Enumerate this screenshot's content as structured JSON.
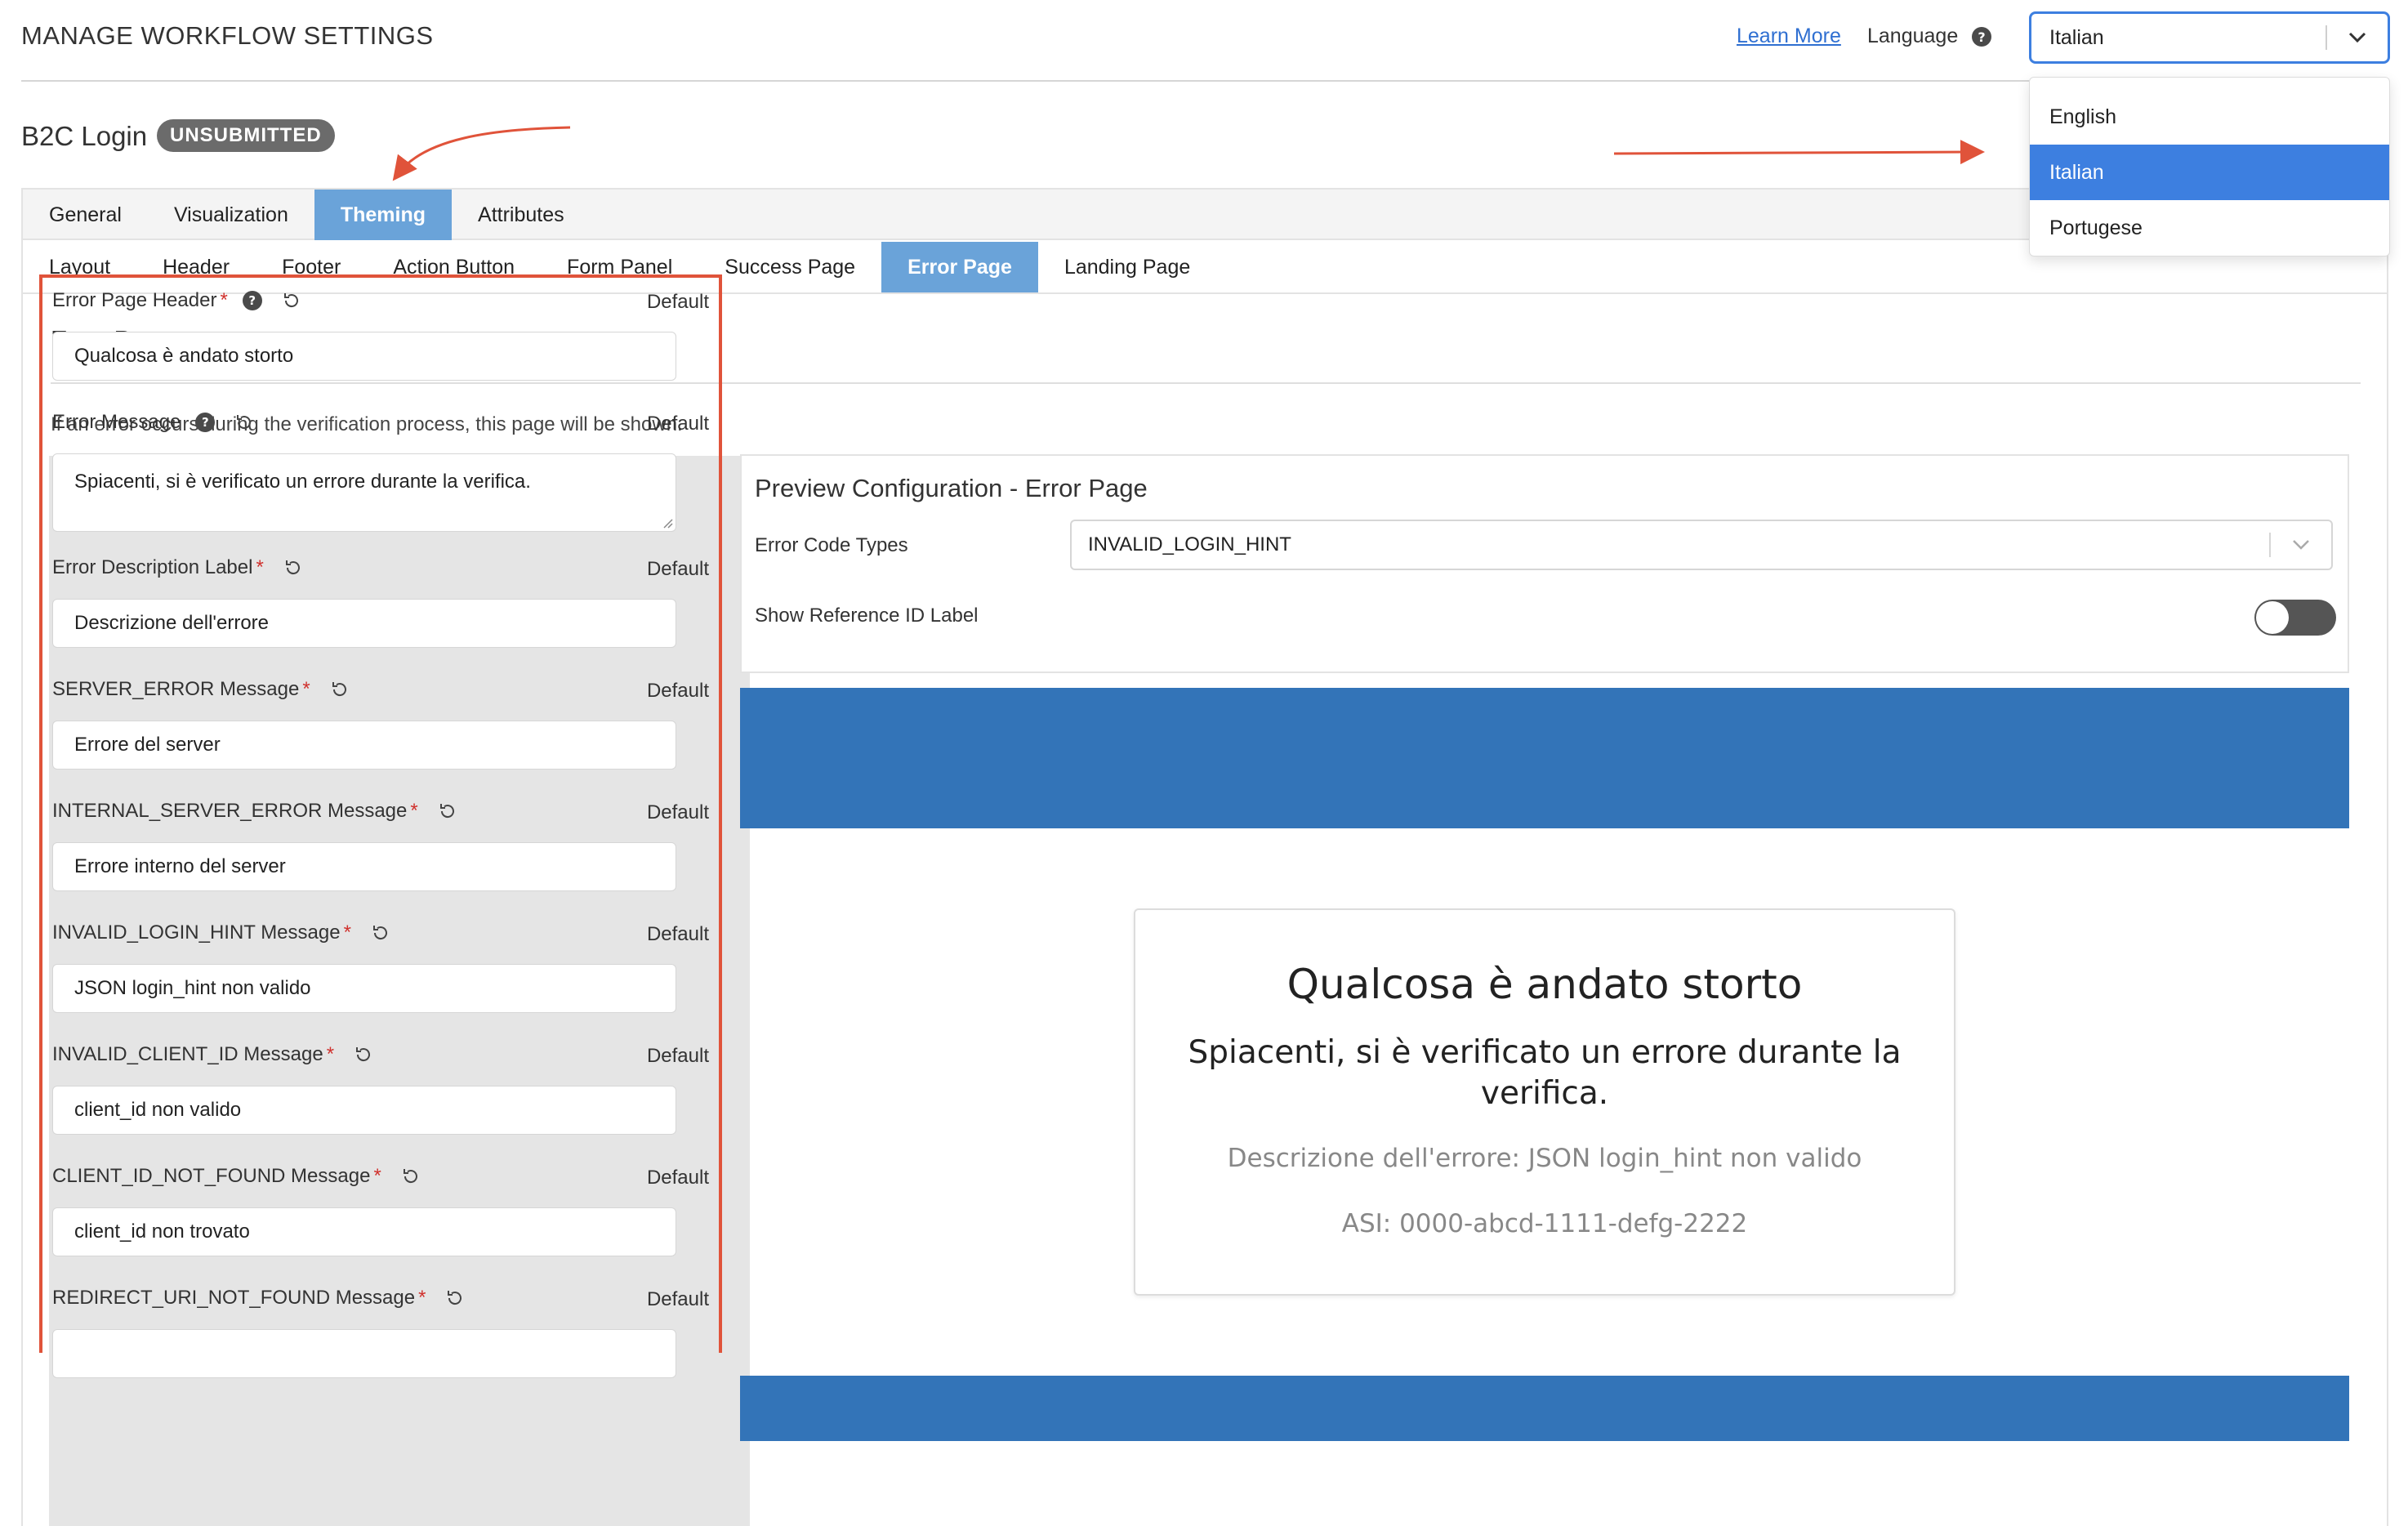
{
  "header": {
    "title": "MANAGE WORKFLOW SETTINGS",
    "learn_more": "Learn More",
    "language_label": "Language",
    "help_glyph": "?"
  },
  "language": {
    "selected": "Italian",
    "options": [
      "English",
      "Italian",
      "Portugese"
    ]
  },
  "workflow": {
    "name": "B2C Login",
    "status": "UNSUBMITTED"
  },
  "tabs": [
    "General",
    "Visualization",
    "Theming",
    "Attributes"
  ],
  "active_tab": "Theming",
  "subtabs": [
    "Layout",
    "Header",
    "Footer",
    "Action Button",
    "Form Panel",
    "Success Page",
    "Error Page",
    "Landing Page"
  ],
  "active_subtab": "Error Page",
  "section": {
    "title": "Error Page",
    "description": "If an error occurs during the verification process, this page will be shown."
  },
  "fields": [
    {
      "label": "Error Page Header",
      "required": true,
      "help": true,
      "value": "Qualcosa è andato storto",
      "default_label": "Default"
    },
    {
      "label": "Error Message",
      "required": false,
      "help": true,
      "value": "Spiacenti, si è verificato un errore durante la verifica.",
      "default_label": "Default",
      "multiline": true
    },
    {
      "label": "Error Description Label",
      "required": true,
      "help": false,
      "value": "Descrizione dell'errore",
      "default_label": "Default"
    },
    {
      "label": "SERVER_ERROR Message",
      "required": true,
      "help": false,
      "value": "Errore del server",
      "default_label": "Default"
    },
    {
      "label": "INTERNAL_SERVER_ERROR Message",
      "required": true,
      "help": false,
      "value": "Errore interno del server",
      "default_label": "Default"
    },
    {
      "label": "INVALID_LOGIN_HINT Message",
      "required": true,
      "help": false,
      "value": "JSON login_hint non valido",
      "default_label": "Default"
    },
    {
      "label": "INVALID_CLIENT_ID Message",
      "required": true,
      "help": false,
      "value": "client_id non valido",
      "default_label": "Default"
    },
    {
      "label": "CLIENT_ID_NOT_FOUND Message",
      "required": true,
      "help": false,
      "value": "client_id non trovato",
      "default_label": "Default"
    },
    {
      "label": "REDIRECT_URI_NOT_FOUND Message",
      "required": true,
      "help": false,
      "value": "",
      "default_label": "Default"
    }
  ],
  "preview": {
    "title": "Preview Configuration - Error Page",
    "error_code_types_label": "Error Code Types",
    "error_code_type": "INVALID_LOGIN_HINT",
    "show_ref_label": "Show Reference ID Label",
    "show_ref_enabled": false,
    "header_color": "#3374b8",
    "card": {
      "heading": "Qualcosa è andato storto",
      "message": "Spiacenti, si è verificato un errore durante la verifica.",
      "description": "Descrizione dell'errore: JSON login_hint non valido",
      "asi": "ASI: 0000-abcd-1111-defg-2222"
    }
  },
  "colors": {
    "accent": "#3d7fe0",
    "active_tab": "#6aa3d9",
    "annotation": "#e0533a",
    "required": "#d0312d"
  }
}
